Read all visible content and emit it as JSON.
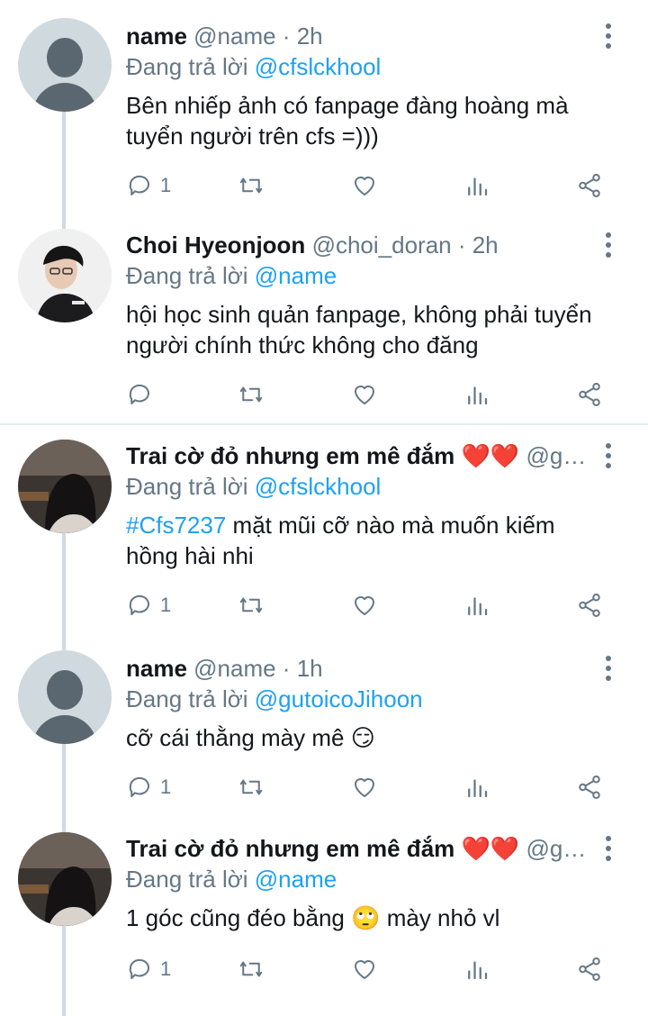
{
  "colors": {
    "accent": "#1da1f2",
    "muted": "#657786",
    "text": "#14171a",
    "thread_line": "#cfd9de"
  },
  "tweets": [
    {
      "display_name": "name",
      "handle_meta": "@name · 2h",
      "replying_prefix": "Đang trả lời ",
      "replying_to": "@cfslckhool",
      "hashtag": "",
      "text": "Bên nhiếp ảnh có fanpage đàng hoàng mà tuyển người trên cfs =)))",
      "reply_count": "1",
      "avatar": "default-avatar"
    },
    {
      "display_name": "Choi Hyeonjoon",
      "handle_meta": "@choi_doran · 2h",
      "replying_prefix": "Đang trả lời ",
      "replying_to": "@name",
      "hashtag": "",
      "text": "hội học sinh quản fanpage, không phải tuyển người chính thức không cho đăng",
      "reply_count": "",
      "avatar": "photo-avatar"
    },
    {
      "display_name": "Trai cờ đỏ nhưng em mê đắm ❤️❤️",
      "handle_meta": "@g…",
      "replying_prefix": "Đang trả lời ",
      "replying_to": "@cfslckhool",
      "hashtag": "#Cfs7237",
      "text": " mặt mũi cỡ nào mà muốn kiếm hồng hài nhi",
      "reply_count": "1",
      "avatar": "photo-avatar"
    },
    {
      "display_name": "name",
      "handle_meta": "@name · 1h",
      "replying_prefix": "Đang trả lời ",
      "replying_to": "@gutoicoJihoon",
      "hashtag": "",
      "text": "cỡ cái thằng mày mê 😏",
      "reply_count": "1",
      "avatar": "default-avatar"
    },
    {
      "display_name": "Trai cờ đỏ nhưng em mê đắm ❤️❤️",
      "handle_meta": "@g…",
      "replying_prefix": "Đang trả lời ",
      "replying_to": "@name",
      "hashtag": "",
      "text": "1 góc cũng đéo bằng 🙄 mày nhỏ vl",
      "reply_count": "1",
      "avatar": "photo-avatar"
    }
  ],
  "icons": {
    "reply": "reply-icon",
    "retweet": "retweet-icon",
    "like": "heart-icon",
    "analytics": "analytics-icon",
    "share": "share-icon",
    "more": "more-vertical-icon"
  }
}
